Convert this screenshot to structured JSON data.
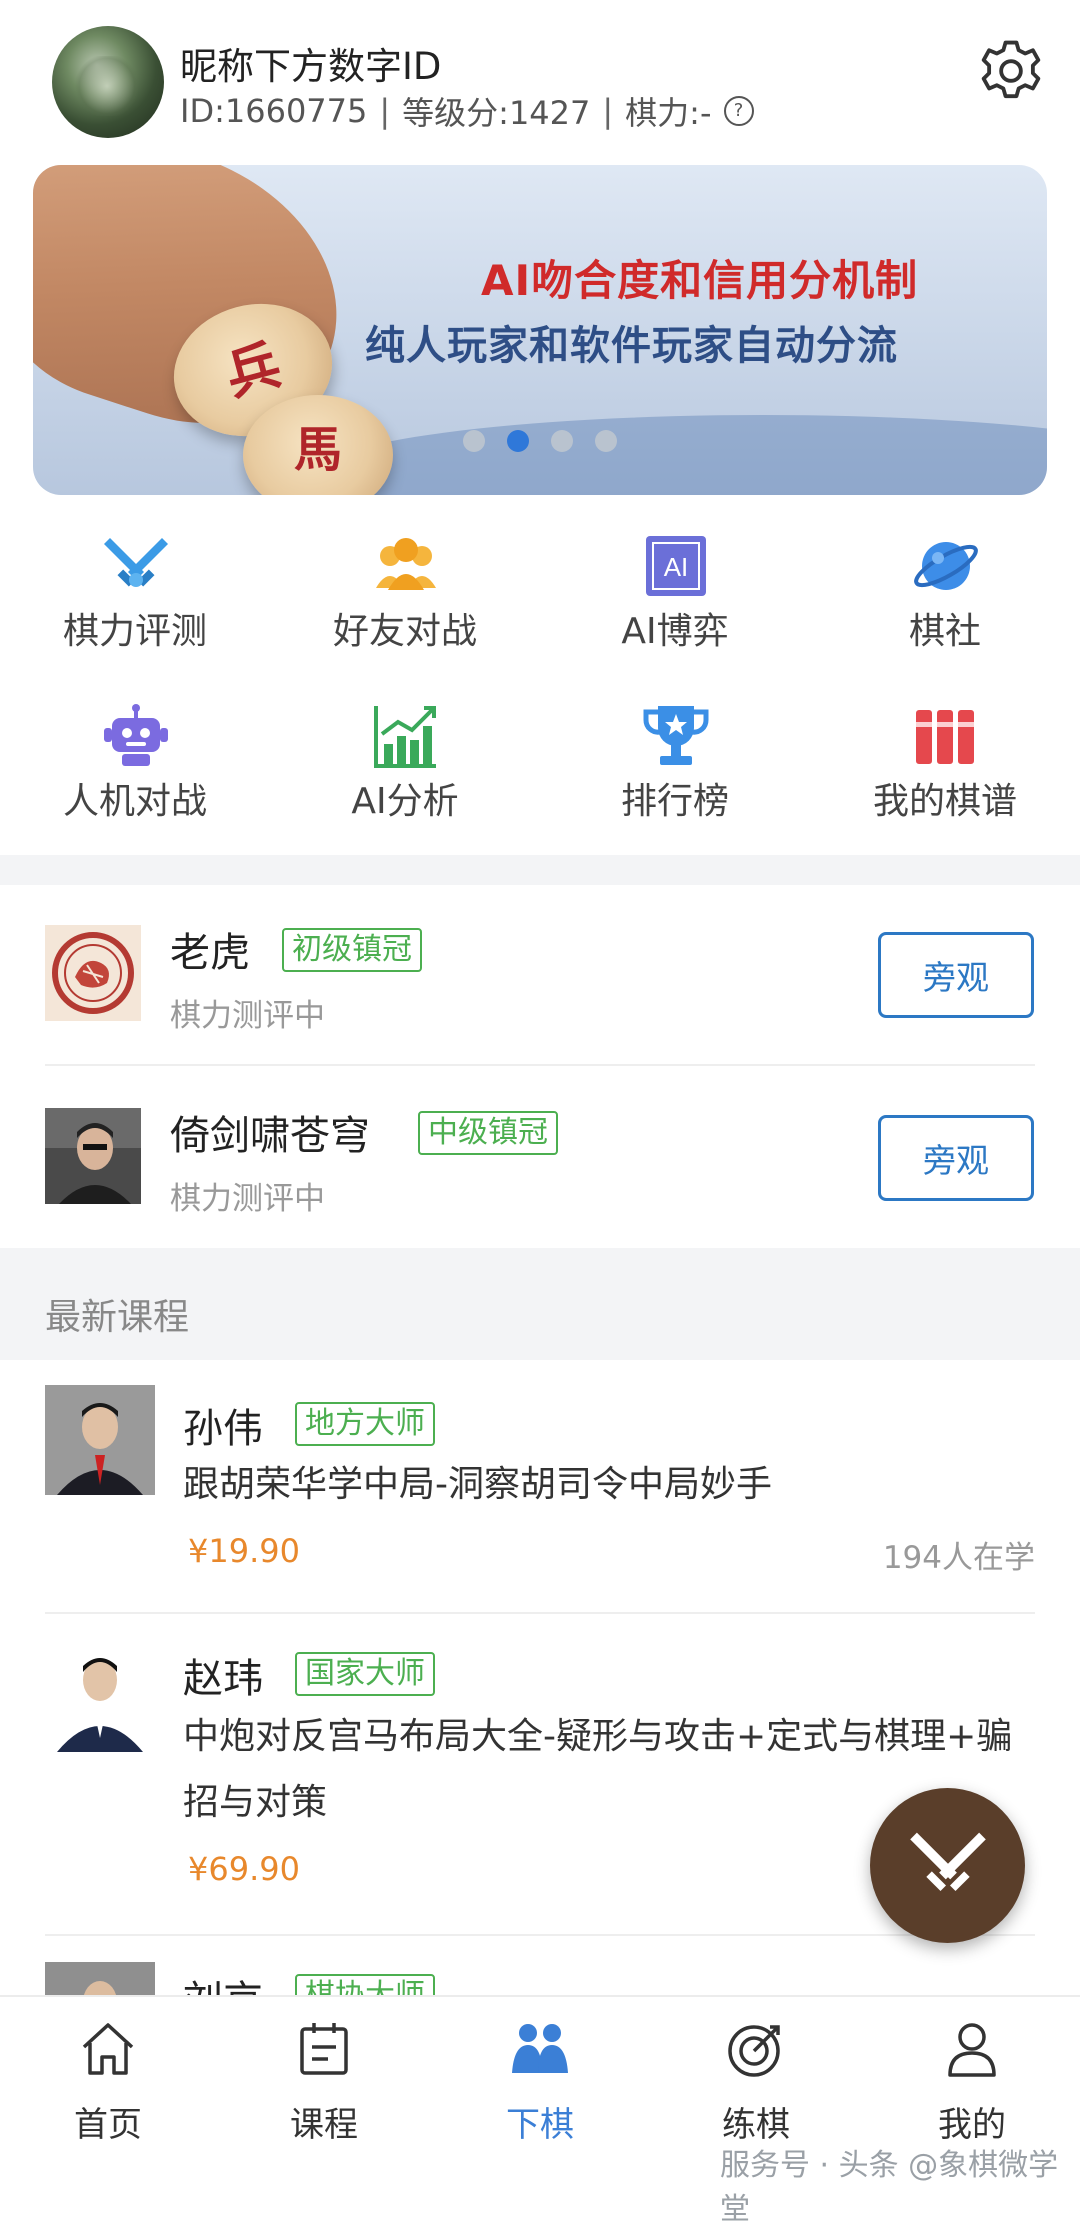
{
  "profile": {
    "nickname": "昵称下方数字ID",
    "id_text": "ID:1660775",
    "rating_text": "等级分:1427",
    "power_text": "棋力:-",
    "separator": "|"
  },
  "banner": {
    "line1": "AI吻合度和信用分机制",
    "line2": "纯人玩家和软件玩家自动分流",
    "piece1": "兵",
    "piece2": "馬",
    "page_count": 4,
    "active_page": 2
  },
  "menu": {
    "items": [
      {
        "label": "棋力评测",
        "icon": "crossed-swords-icon"
      },
      {
        "label": "好友对战",
        "icon": "friends-icon"
      },
      {
        "label": "AI博弈",
        "icon": "ai-icon"
      },
      {
        "label": "棋社",
        "icon": "planet-icon"
      },
      {
        "label": "人机对战",
        "icon": "robot-icon"
      },
      {
        "label": "AI分析",
        "icon": "chart-icon"
      },
      {
        "label": "排行榜",
        "icon": "trophy-icon"
      },
      {
        "label": "我的棋谱",
        "icon": "books-icon"
      }
    ],
    "ai_glyph": "AI"
  },
  "players": [
    {
      "name": "老虎",
      "badge": "初级镇冠",
      "status": "棋力测评中",
      "button": "旁观"
    },
    {
      "name": "倚剑啸苍穹",
      "badge": "中级镇冠",
      "status": "棋力测评中",
      "button": "旁观"
    }
  ],
  "courses_section": {
    "title": "最新课程"
  },
  "courses": [
    {
      "teacher": "孙伟",
      "badge": "地方大师",
      "title": "跟胡荣华学中局-洞察胡司令中局妙手",
      "price": "¥19.90",
      "learners": "194人在学"
    },
    {
      "teacher": "赵玮",
      "badge": "国家大师",
      "title": "中炮对反宫马布局大全-疑形与攻击+定式与棋理+骗招与对策",
      "price": "¥69.90",
      "learners": ""
    },
    {
      "teacher": "刘京",
      "badge": "棋协大师",
      "title": "",
      "price": "",
      "learners": ""
    }
  ],
  "tabbar": {
    "tabs": [
      {
        "label": "首页",
        "icon": "home-icon"
      },
      {
        "label": "课程",
        "icon": "calendar-icon"
      },
      {
        "label": "下棋",
        "icon": "play-chess-icon",
        "active": true
      },
      {
        "label": "练棋",
        "icon": "target-icon"
      },
      {
        "label": "我的",
        "icon": "user-icon"
      }
    ]
  },
  "watermark": "服务号 · 头条 @象棋微学堂",
  "colors": {
    "accent": "#3b7fd6",
    "badge_green": "#4caf50",
    "price_orange": "#e8882c",
    "fab_brown": "#5a3e2a",
    "banner_red": "#d02a2a"
  }
}
